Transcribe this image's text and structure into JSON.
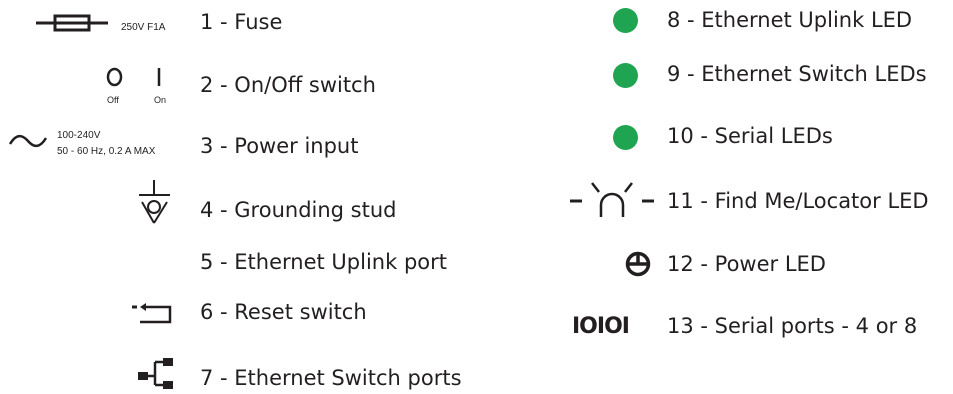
{
  "colors": {
    "text": "#231f20",
    "led_green": "#1fa551"
  },
  "fuse": {
    "icon": "fuse-icon",
    "rating": "250V F1A"
  },
  "switch": {
    "icon": "on-off-switch-icon",
    "off": "Off",
    "on": "On"
  },
  "power_input": {
    "icon": "ac-tilde-icon",
    "line1": "100-240V",
    "line2": "50 - 60 Hz, 0.2 A MAX"
  },
  "grounding": {
    "icon": "ground-stud-icon"
  },
  "reset": {
    "icon": "reset-arrow-icon"
  },
  "ethernet_switch": {
    "icon": "network-tree-icon"
  },
  "find_me": {
    "icon": "beacon-icon"
  },
  "power_led": {
    "icon": "power-icon"
  },
  "serial_ports": {
    "icon": "serial-ports-icon",
    "glyph": "IOIOI"
  },
  "legend": {
    "left": [
      {
        "label": "1 - Fuse"
      },
      {
        "label": "2 - On/Off switch"
      },
      {
        "label": "3 - Power input"
      },
      {
        "label": "4 - Grounding stud"
      },
      {
        "label": "5 - Ethernet Uplink port"
      },
      {
        "label": "6 - Reset switch"
      },
      {
        "label": "7 - Ethernet Switch ports"
      }
    ],
    "right": [
      {
        "label": "8 - Ethernet Uplink LED"
      },
      {
        "label": "9 - Ethernet Switch LEDs"
      },
      {
        "label": "10 - Serial LEDs"
      },
      {
        "label": "11 - Find Me/Locator LED"
      },
      {
        "label": "12 - Power LED"
      },
      {
        "label": "13 - Serial ports - 4 or 8"
      }
    ]
  }
}
